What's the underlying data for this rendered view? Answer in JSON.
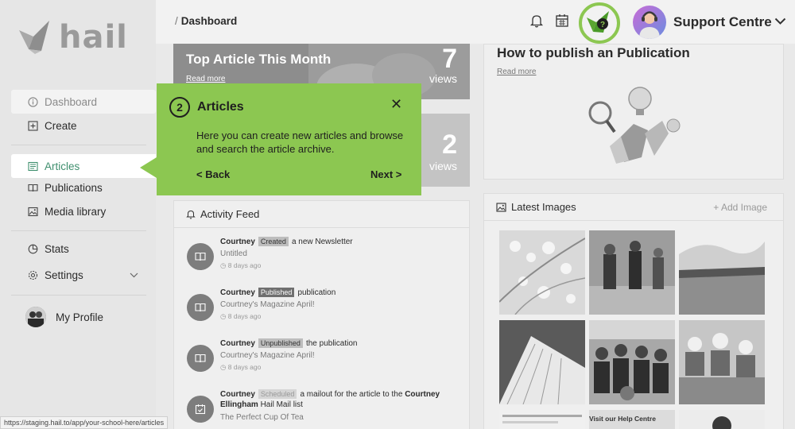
{
  "brand": {
    "logo_text": "hail"
  },
  "sidebar": {
    "items": [
      {
        "label": "Dashboard",
        "icon": "info-circle-icon"
      },
      {
        "label": "Create",
        "icon": "plus-square-icon"
      },
      {
        "label": "Articles",
        "icon": "article-icon"
      },
      {
        "label": "Publications",
        "icon": "book-open-icon"
      },
      {
        "label": "Media library",
        "icon": "image-icon"
      },
      {
        "label": "Stats",
        "icon": "pie-chart-icon"
      },
      {
        "label": "Settings",
        "icon": "gear-icon"
      },
      {
        "label": "My Profile",
        "icon": "avatar"
      }
    ]
  },
  "header": {
    "breadcrumb": "Dashboard",
    "user_name": "Support Centre"
  },
  "stats": [
    {
      "title": "Top Article This Month",
      "link": "Read more",
      "number": "7",
      "unit": "views"
    },
    {
      "number": "2",
      "unit": "views"
    }
  ],
  "how_to": {
    "title": "How to publish an Publication",
    "link": "Read more"
  },
  "activity_feed": {
    "title": "Activity Feed",
    "items": [
      {
        "user": "Courtney",
        "badge": "Created",
        "action": "a new Newsletter",
        "subject": "Untitled",
        "time": "8 days ago"
      },
      {
        "user": "Courtney",
        "badge": "Published",
        "action": "publication",
        "subject": "Courtney's Magazine April!",
        "time": "8 days ago"
      },
      {
        "user": "Courtney",
        "badge": "Unpublished",
        "action": "the publication",
        "subject": "Courtney's Magazine April!",
        "time": "8 days ago"
      },
      {
        "user": "Courtney",
        "badge": "Scheduled",
        "action": "a mailout for the article to the",
        "target": "Courtney Ellingham",
        "target_suffix": "Hail Mail list",
        "subject": "The Perfect Cup Of Tea"
      }
    ]
  },
  "latest_images": {
    "title": "Latest Images",
    "add_label": "+ Add Image",
    "tile_caption": "Visit our Help Centre"
  },
  "tooltip": {
    "step": "2",
    "title": "Articles",
    "close": "✕",
    "body": "Here you can create new articles and browse and search the article archive.",
    "back": "< Back",
    "next": "Next >"
  },
  "status_bar": {
    "url": "https://staging.hail.to/app/your-school-here/articles"
  },
  "colors": {
    "accent_green": "#8cc751",
    "active_text": "#3f8f6e"
  }
}
